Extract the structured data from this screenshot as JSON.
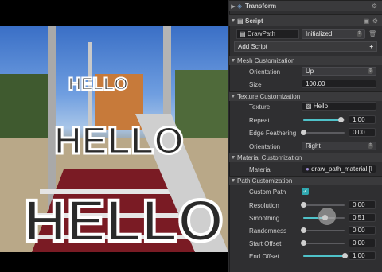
{
  "transform": {
    "title": "Transform"
  },
  "script": {
    "title": "Script",
    "name": "DrawPath",
    "status": "Initialized",
    "add_label": "Add Script"
  },
  "mesh": {
    "title": "Mesh Customization",
    "orientation_label": "Orientation",
    "orientation_value": "Up",
    "size_label": "Size",
    "size_value": "100.00"
  },
  "texture": {
    "title": "Texture Customization",
    "texture_label": "Texture",
    "texture_value": "Hello",
    "repeat_label": "Repeat",
    "repeat_value": "1.00",
    "repeat_fraction": 0.9,
    "feather_label": "Edge Feathering",
    "feather_value": "0.00",
    "feather_fraction": 0.0,
    "orientation_label": "Orientation",
    "orientation_value": "Right"
  },
  "material": {
    "title": "Material Customization",
    "material_label": "Material",
    "material_value": "draw_path_material [I"
  },
  "path": {
    "title": "Path Customization",
    "custom_label": "Custom Path",
    "custom_checked": true,
    "resolution_label": "Resolution",
    "resolution_value": "0.00",
    "resolution_fraction": 0.0,
    "smoothing_label": "Smoothing",
    "smoothing_value": "0.51",
    "smoothing_fraction": 0.51,
    "randomness_label": "Randomness",
    "randomness_value": "0.00",
    "randomness_fraction": 0.0,
    "start_label": "Start Offset",
    "start_value": "0.00",
    "start_fraction": 0.0,
    "end_label": "End Offset",
    "end_value": "1.00",
    "end_fraction": 1.0
  },
  "viewport": {
    "text": "HELLO"
  },
  "colors": {
    "accent": "#4fc2c9",
    "panel": "#2f2f31",
    "header": "#3a3a3c"
  }
}
